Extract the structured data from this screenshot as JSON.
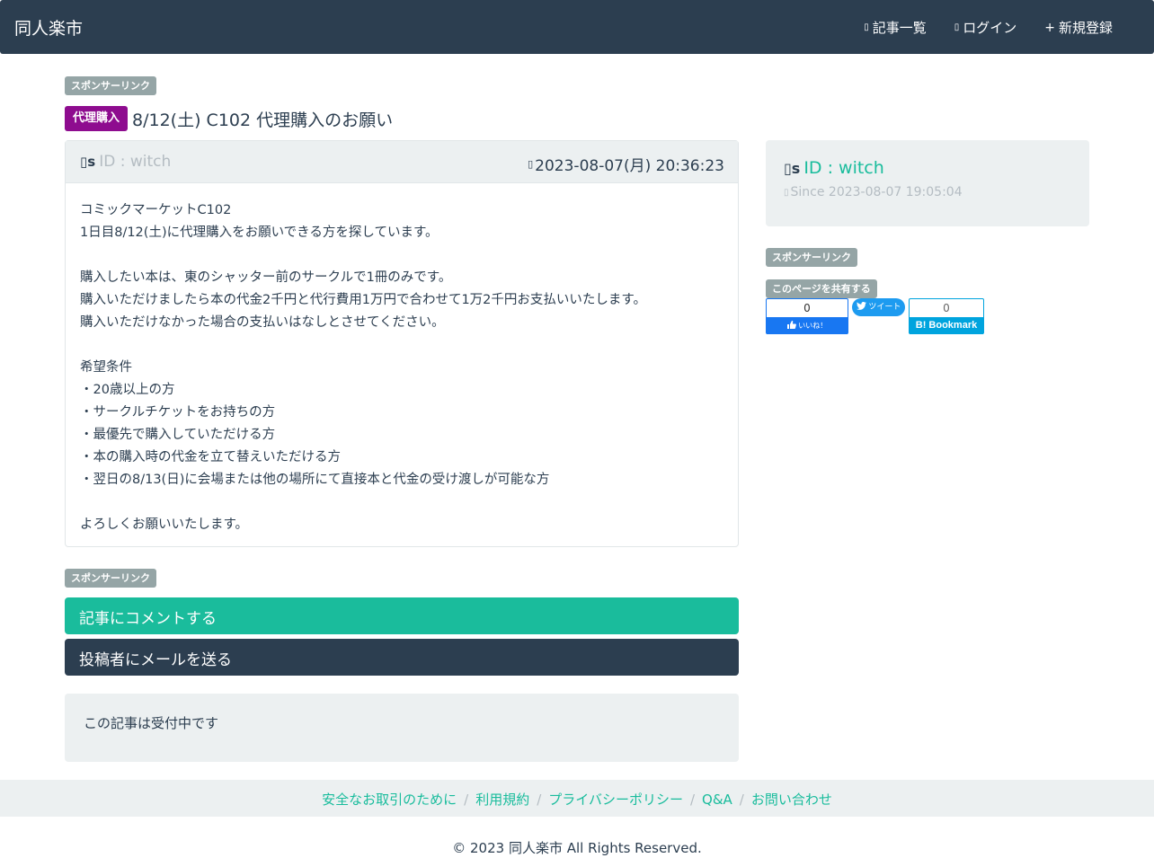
{
  "nav": {
    "brand": "同人楽市",
    "links": [
      {
        "icon": "list-icon",
        "label": "記事一覧",
        "glyph": "▯"
      },
      {
        "icon": "login-icon",
        "label": "ログイン",
        "glyph": "▯"
      },
      {
        "icon": "plus-icon",
        "label": "新規登録",
        "glyph": "+"
      }
    ]
  },
  "ads": {
    "sponsor_label": "スポンサーリンク"
  },
  "post": {
    "category": "代理購入",
    "category_color": "#8e0c8f",
    "title": "8/12(土) C102 代理購入のお願い",
    "author_glyph": "▯s",
    "author_id": "ID : witch",
    "timestamp_glyph": "▯",
    "timestamp": "2023-08-07(月) 20:36:23",
    "body": [
      "コミックマーケットC102",
      "1日目8/12(土)に代理購入をお願いできる方を探しています。",
      "",
      "購入したい本は、東のシャッター前のサークルで1冊のみです。",
      "購入いただけましたら本の代金2千円と代行費用1万円で合わせて1万2千円お支払いいたします。",
      "購入いただけなかった場合の支払いはなしとさせてください。",
      "",
      "希望条件",
      "・20歳以上の方",
      "・サークルチケットをお持ちの方",
      "・最優先で購入していただける方",
      "・本の購入時の代金を立て替えいただける方",
      "・翌日の8/13(日)に会場または他の場所にて直接本と代金の受け渡しが可能な方",
      "",
      "よろしくお願いいたします。"
    ]
  },
  "actions": {
    "comment": "記事にコメントする",
    "mail": "投稿者にメールを送る"
  },
  "status": "この記事は受付中です",
  "sidebar": {
    "user_glyph": "▯s",
    "user_id": "ID : witch",
    "since_glyph": "▯",
    "since": "Since 2023-08-07 19:05:04",
    "share_label": "このページを共有する",
    "fb_count": "0",
    "fb_label": "いいね！",
    "tw_label": "ツイート",
    "hb_count": "0",
    "hb_label": "B! Bookmark"
  },
  "footer": {
    "links": [
      "安全なお取引のために",
      "利用規約",
      "プライバシーポリシー",
      "Q&A",
      "お問い合わせ"
    ],
    "copyright": "© 2023 同人楽市 All Rights Reserved."
  },
  "colors": {
    "navbar": "#2c3e50",
    "accent": "#18bc9c",
    "sponsor_tag": "#95a5a6"
  }
}
